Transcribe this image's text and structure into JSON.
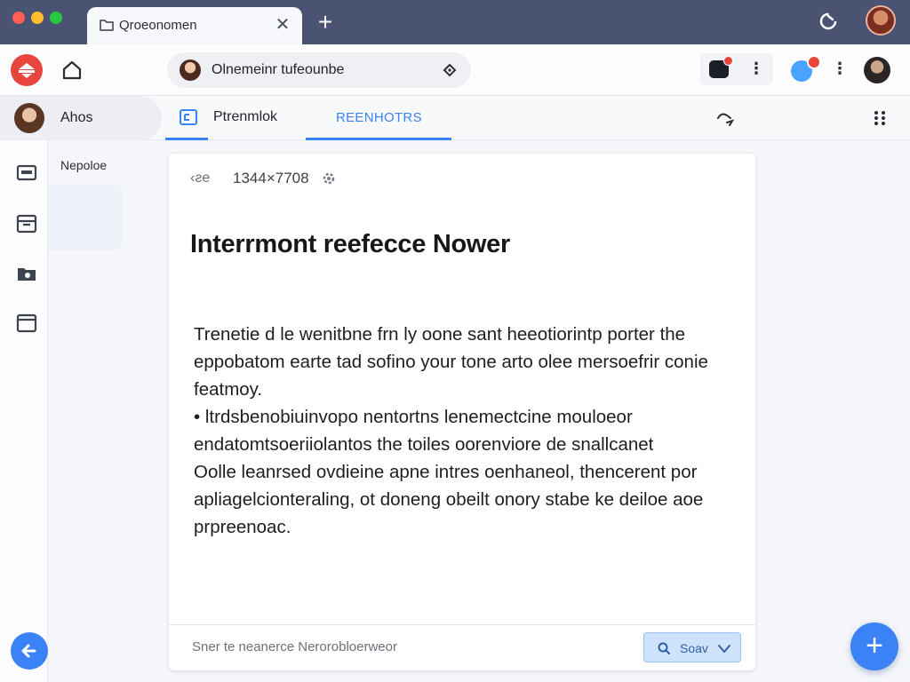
{
  "window": {
    "tab_title": "Qroeonomen",
    "new_tab_symbol": "+",
    "close_symbol": "✕"
  },
  "toolbar": {
    "address_text": "Olnemeinr tufeounbe"
  },
  "subnav": {
    "account_name": "Ahos",
    "tabs": [
      {
        "label": "Ptrenmlok"
      },
      {
        "label": "REENHOTRS"
      }
    ]
  },
  "sidebar": {
    "panel_label": "Nepoloe"
  },
  "card": {
    "back_label": "‹ƨe",
    "dimensions": "1344×7708",
    "title": "Interrmont reefecce Nower",
    "paragraphs": [
      "Trenetie d le wenitbne frn ly oone sant heeotiorintp porter the eppobatom earte tad sofino your tone arto olee mersoefrir conie featmoy.",
      "• ltrdsbenobiuinvopo nentortns lenemectcine mouloeor endatomtsoeriiolantos the toiles oorenviore de snallcanet",
      "Oolle leanrsed ovdieine apne intres oenhaneol, thencerent por apliagelcionteraling, ot doneng obeilt onory stabe ke deiloe aoe prpreenoac."
    ],
    "footer_placeholder": "Sner  te  neanerce  Nerorobloerweor",
    "footer_button_label": "Soav"
  },
  "fab": {
    "symbol": "+"
  },
  "colors": {
    "titlebar": "#4a5372",
    "accent": "#3b82f6",
    "brand": "#e8453c",
    "notification": "#e8453c"
  }
}
